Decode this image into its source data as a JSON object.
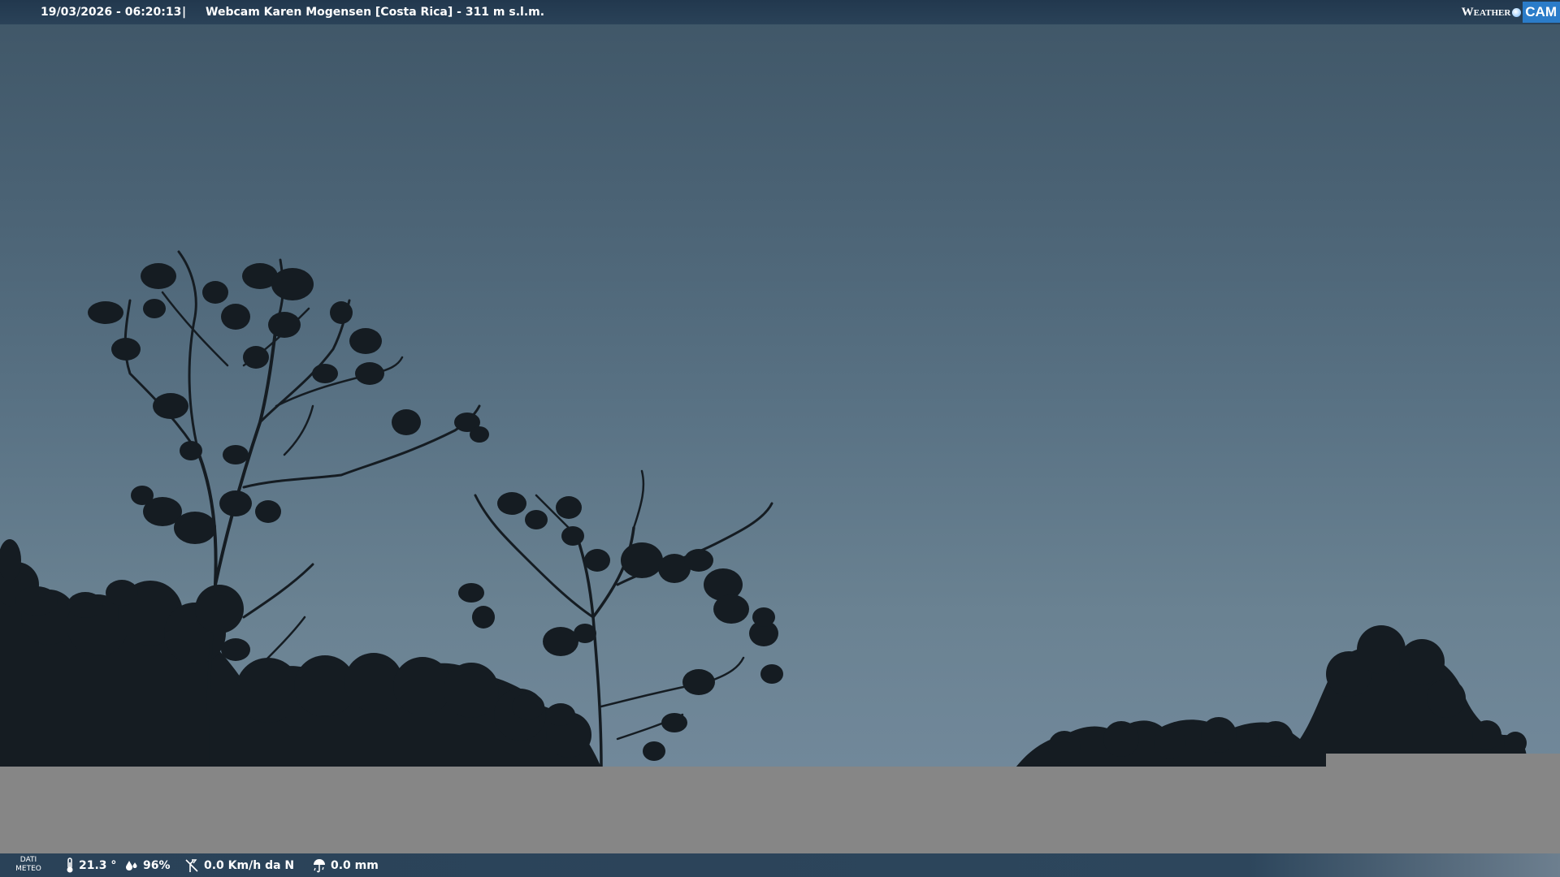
{
  "top_bar": {
    "datetime": "19/03/2026 - 06:20:13",
    "separator": "|",
    "title": "Webcam Karen Mogensen [Costa Rica]  - 311 m s.l.m."
  },
  "logo": {
    "left_text": "Weather",
    "right_text": "CAM"
  },
  "bottom_bar": {
    "label_line1": "DATI",
    "label_line2": "METEO",
    "temperature": "21.3 °",
    "humidity": "96%",
    "wind": "0.0 Km/h da N",
    "rain": "0.0 mm",
    "icons": [
      "thermometer-icon",
      "humidity-icon",
      "wind-icon",
      "rain-icon"
    ]
  },
  "colors": {
    "bar": "#2a4258",
    "sky_top": "#3f5667",
    "sky_bottom": "#71889a",
    "gray_band": "#868686",
    "logo_accent": "#2b7cc9"
  }
}
